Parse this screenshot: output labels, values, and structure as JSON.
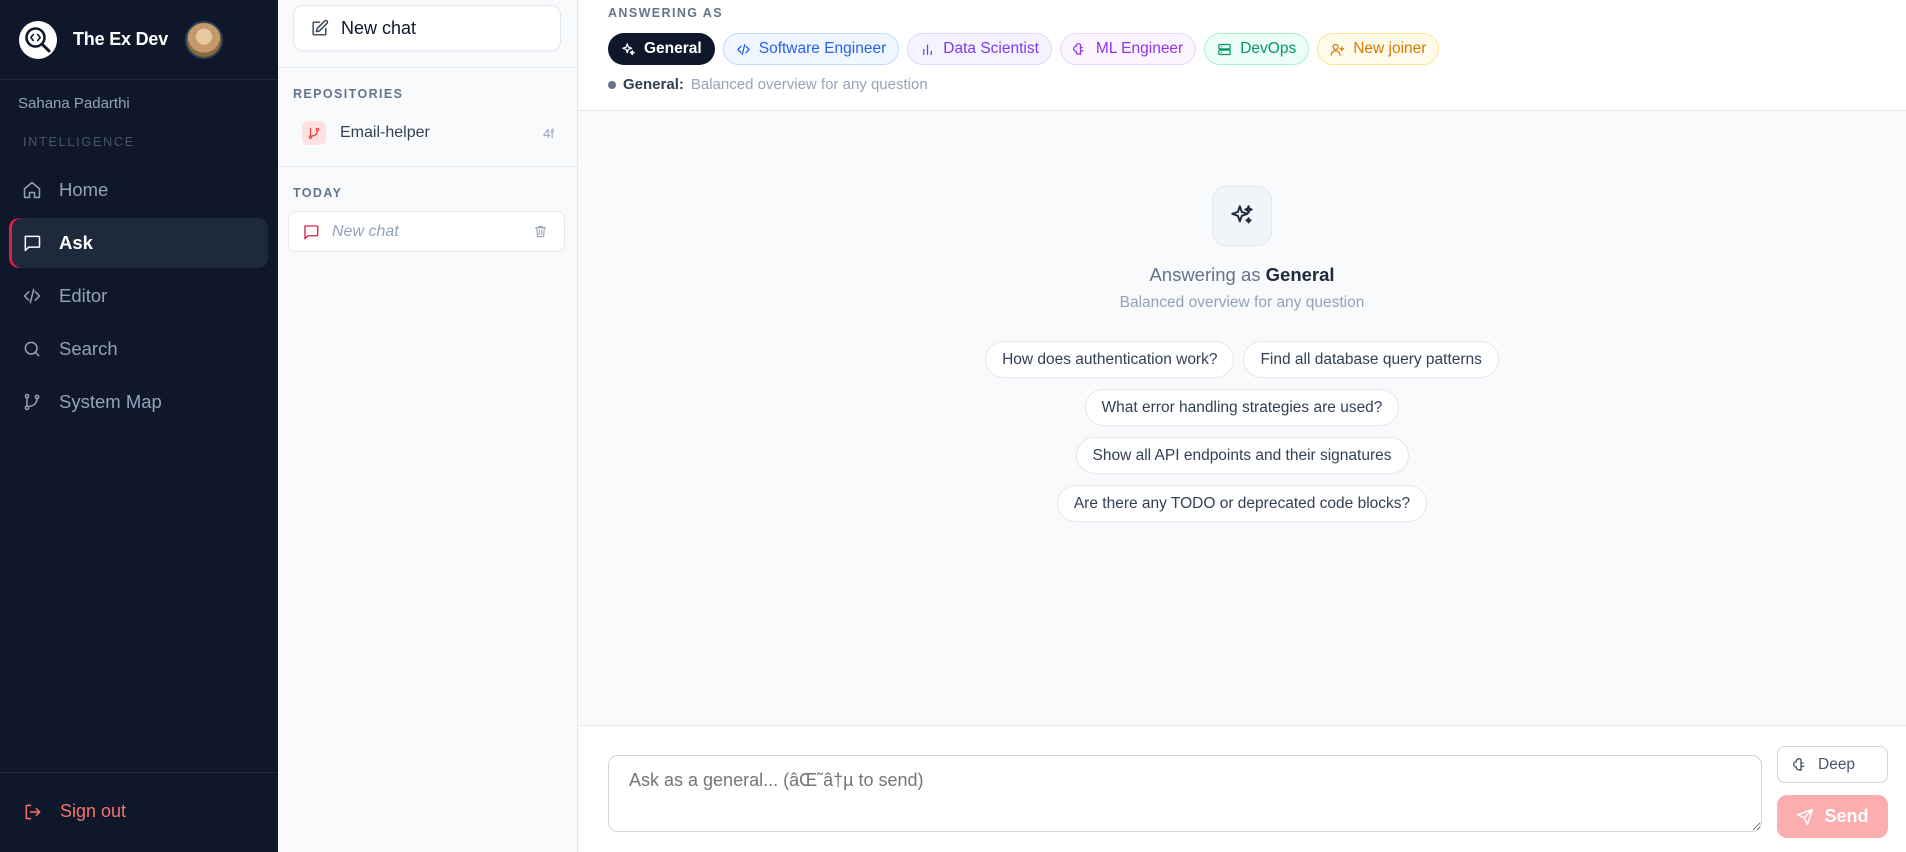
{
  "app": {
    "name": "The Ex Dev",
    "user_name": "Sahana Padarthi"
  },
  "sidebar": {
    "section_label": "INTELLIGENCE",
    "items": [
      {
        "label": "Home",
        "icon": "home-icon",
        "active": false
      },
      {
        "label": "Ask",
        "icon": "chat-bubble-icon",
        "active": true
      },
      {
        "label": "Editor",
        "icon": "code-icon",
        "active": false
      },
      {
        "label": "Search",
        "icon": "search-icon",
        "active": false
      },
      {
        "label": "System Map",
        "icon": "git-branch-icon",
        "active": false
      }
    ],
    "sign_out_label": "Sign out"
  },
  "chat_panel": {
    "new_chat_label": "New chat",
    "repositories_label": "REPOSITORIES",
    "repositories": [
      {
        "name": "Email-helper",
        "count": "4f"
      }
    ],
    "today_label": "TODAY",
    "chats": [
      {
        "title": "New chat"
      }
    ]
  },
  "header": {
    "answering_as_label": "ANSWERING AS",
    "personas": [
      {
        "label": "General",
        "icon": "sparkles-icon",
        "selected": true
      },
      {
        "label": "Software Engineer",
        "icon": "code-icon",
        "selected": false
      },
      {
        "label": "Data Scientist",
        "icon": "bar-chart-icon",
        "selected": false
      },
      {
        "label": "ML Engineer",
        "icon": "brain-icon",
        "selected": false
      },
      {
        "label": "DevOps",
        "icon": "server-icon",
        "selected": false
      },
      {
        "label": "New joiner",
        "icon": "user-plus-icon",
        "selected": false
      }
    ],
    "active_persona_name": "General:",
    "active_persona_description": "Balanced overview for any question"
  },
  "empty_state": {
    "title_prefix": "Answering as",
    "title_persona": "General",
    "subtitle": "Balanced overview for any question",
    "suggestions": [
      "How does authentication work?",
      "Find all database query patterns",
      "What error handling strategies are used?",
      "Show all API endpoints and their signatures",
      "Are there any TODO or deprecated code blocks?"
    ]
  },
  "composer": {
    "placeholder": "Ask as a general... (âŒ˜â†µ to send)",
    "deep_label": "Deep",
    "send_label": "Send"
  },
  "colors": {
    "sidebar_bg": "#0f172a",
    "accent": "#e11d48",
    "send_button": "#fca5a5"
  }
}
